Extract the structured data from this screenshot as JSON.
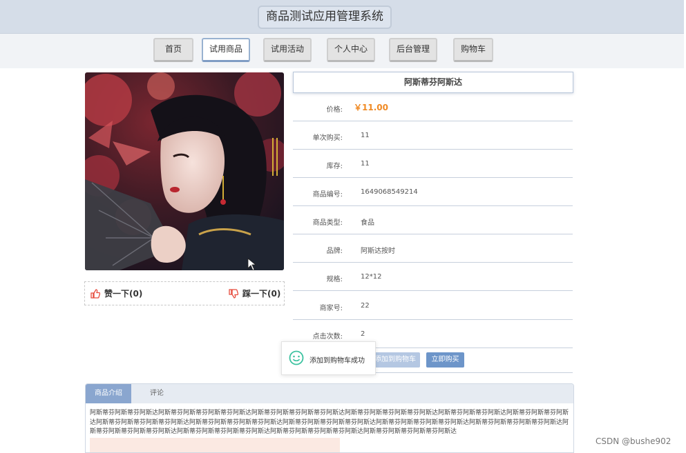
{
  "app": {
    "title": "商品测试应用管理系统"
  },
  "nav": {
    "items": [
      {
        "label": "首页"
      },
      {
        "label": "试用商品"
      },
      {
        "label": "试用活动"
      },
      {
        "label": "个人中心"
      },
      {
        "label": "后台管理"
      },
      {
        "label": "购物车"
      }
    ],
    "active": "试用商品"
  },
  "product": {
    "name": "阿斯蒂芬阿斯达",
    "photo_icon": "woman-with-fan-photo",
    "vote": {
      "like_label": "赞一下(0)",
      "dislike_label": "踩一下(0)"
    },
    "details": [
      {
        "label": "价格:",
        "value": "￥11.00"
      },
      {
        "label": "单次购买:",
        "value": "11"
      },
      {
        "label": "库存:",
        "value": "11"
      },
      {
        "label": "商品编号:",
        "value": "1649068549214"
      },
      {
        "label": "商品类型:",
        "value": "食品"
      },
      {
        "label": "品牌:",
        "value": "阿斯达按时"
      },
      {
        "label": "规格:",
        "value": "12*12"
      },
      {
        "label": "商家号:",
        "value": "22"
      },
      {
        "label": "点击次数:",
        "value": "2"
      }
    ],
    "actions": {
      "add_cart_label": "添加到购物车",
      "buy_now_label": "立即购买"
    }
  },
  "toast": {
    "message": "添加到购物车成功",
    "icon": "smile-icon"
  },
  "tabs": {
    "items": [
      {
        "label": "商品介绍"
      },
      {
        "label": "评论"
      }
    ],
    "active": "商品介绍",
    "description": "阿斯蒂芬阿斯蒂芬阿斯达阿斯蒂芬阿斯蒂芬阿斯蒂芬阿斯达阿斯蒂芬阿斯蒂芬阿斯蒂芬阿斯达阿斯蒂芬阿斯蒂芬阿斯蒂芬阿斯达阿斯蒂芬阿斯蒂芬阿斯达阿斯蒂芬阿斯蒂芬阿斯达阿斯蒂芬阿斯蒂芬阿斯蒂芬阿斯达阿斯蒂芬阿斯蒂芬阿斯蒂芬阿斯达阿斯蒂芬阿斯蒂芬阿斯蒂芬阿斯达阿斯蒂芬阿斯蒂芬阿斯蒂芬阿斯达阿斯蒂芬阿斯蒂芬阿斯蒂芬阿斯达阿斯蒂芬阿斯蒂芬阿斯蒂芬阿斯达阿斯蒂芬阿斯蒂芬阿斯蒂芬阿斯达阿斯蒂芬阿斯蒂芬阿斯蒂芬阿斯达阿斯蒂芬阿斯蒂芬阿斯蒂芬阿斯达"
  },
  "watermark": "CSDN @bushe902",
  "colors": {
    "accent": "#8aa6cf",
    "price": "#f08a24",
    "buy_button": "#6d95c9",
    "cart_button_disabled": "#b4c7e2",
    "toast_icon": "#3cc2a0"
  }
}
